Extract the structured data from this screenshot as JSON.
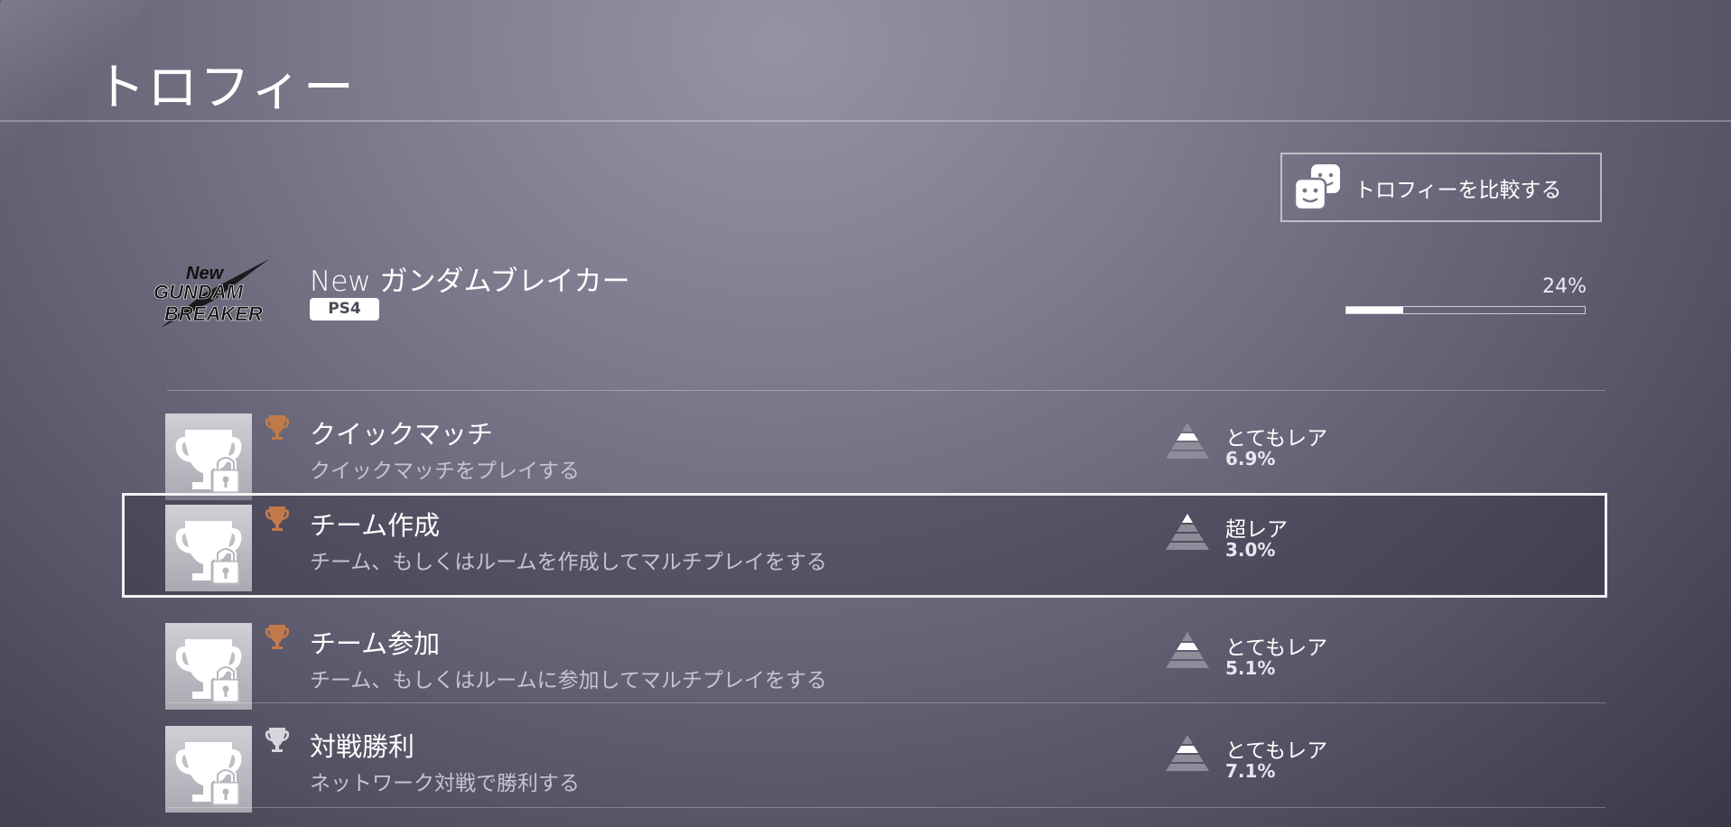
{
  "page": {
    "title": "トロフィー"
  },
  "compare_button": {
    "label": "トロフィーを比較する",
    "icon": "faces-icon"
  },
  "game": {
    "title": "New ガンダムブレイカー",
    "platform": "PS4",
    "logo_text": [
      "New",
      "GUNDAM",
      "BREAKER"
    ],
    "progress_label": "24%",
    "progress_fraction": 0.24
  },
  "trophies": [
    {
      "name": "クイックマッチ",
      "description": "クイックマッチをプレイする",
      "grade": "bronze",
      "rarity_label": "とてもレア",
      "rarity_percent": "6.9%",
      "rarity_level": "very-rare",
      "locked": true
    },
    {
      "name": "チーム作成",
      "description": "チーム、もしくはルームを作成してマルチプレイをする",
      "grade": "bronze",
      "rarity_label": "超レア",
      "rarity_percent": "3.0%",
      "rarity_level": "ultra-rare",
      "locked": true,
      "selected": true
    },
    {
      "name": "チーム参加",
      "description": "チーム、もしくはルームに参加してマルチプレイをする",
      "grade": "bronze",
      "rarity_label": "とてもレア",
      "rarity_percent": "5.1%",
      "rarity_level": "very-rare",
      "locked": true
    },
    {
      "name": "対戦勝利",
      "description": "ネットワーク対戦で勝利する",
      "grade": "silver",
      "rarity_label": "とてもレア",
      "rarity_percent": "7.1%",
      "rarity_level": "very-rare",
      "locked": true
    }
  ],
  "colors": {
    "bronze": "#c07a4a",
    "silver": "#d6d6dc",
    "accent_white": "#ffffff"
  }
}
